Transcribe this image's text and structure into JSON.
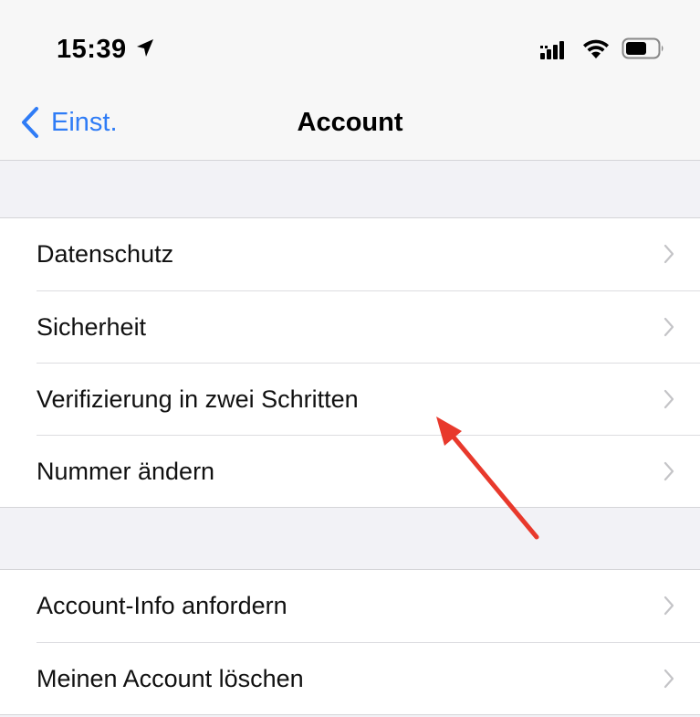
{
  "status_bar": {
    "time": "15:39",
    "icons": [
      "location-arrow-icon",
      "cellular-signal-icon",
      "wifi-icon",
      "battery-icon"
    ]
  },
  "nav": {
    "back_label": "Einst.",
    "title": "Account"
  },
  "groups": [
    {
      "rows": [
        {
          "label": "Datenschutz"
        },
        {
          "label": "Sicherheit"
        },
        {
          "label": "Verifizierung in zwei Schritten"
        },
        {
          "label": "Nummer ändern"
        }
      ]
    },
    {
      "rows": [
        {
          "label": "Account-Info anfordern"
        },
        {
          "label": "Meinen Account löschen"
        }
      ]
    }
  ],
  "colors": {
    "accent": "#2f7cf6",
    "annotation_arrow": "#e8392c",
    "background": "#f2f2f6"
  }
}
